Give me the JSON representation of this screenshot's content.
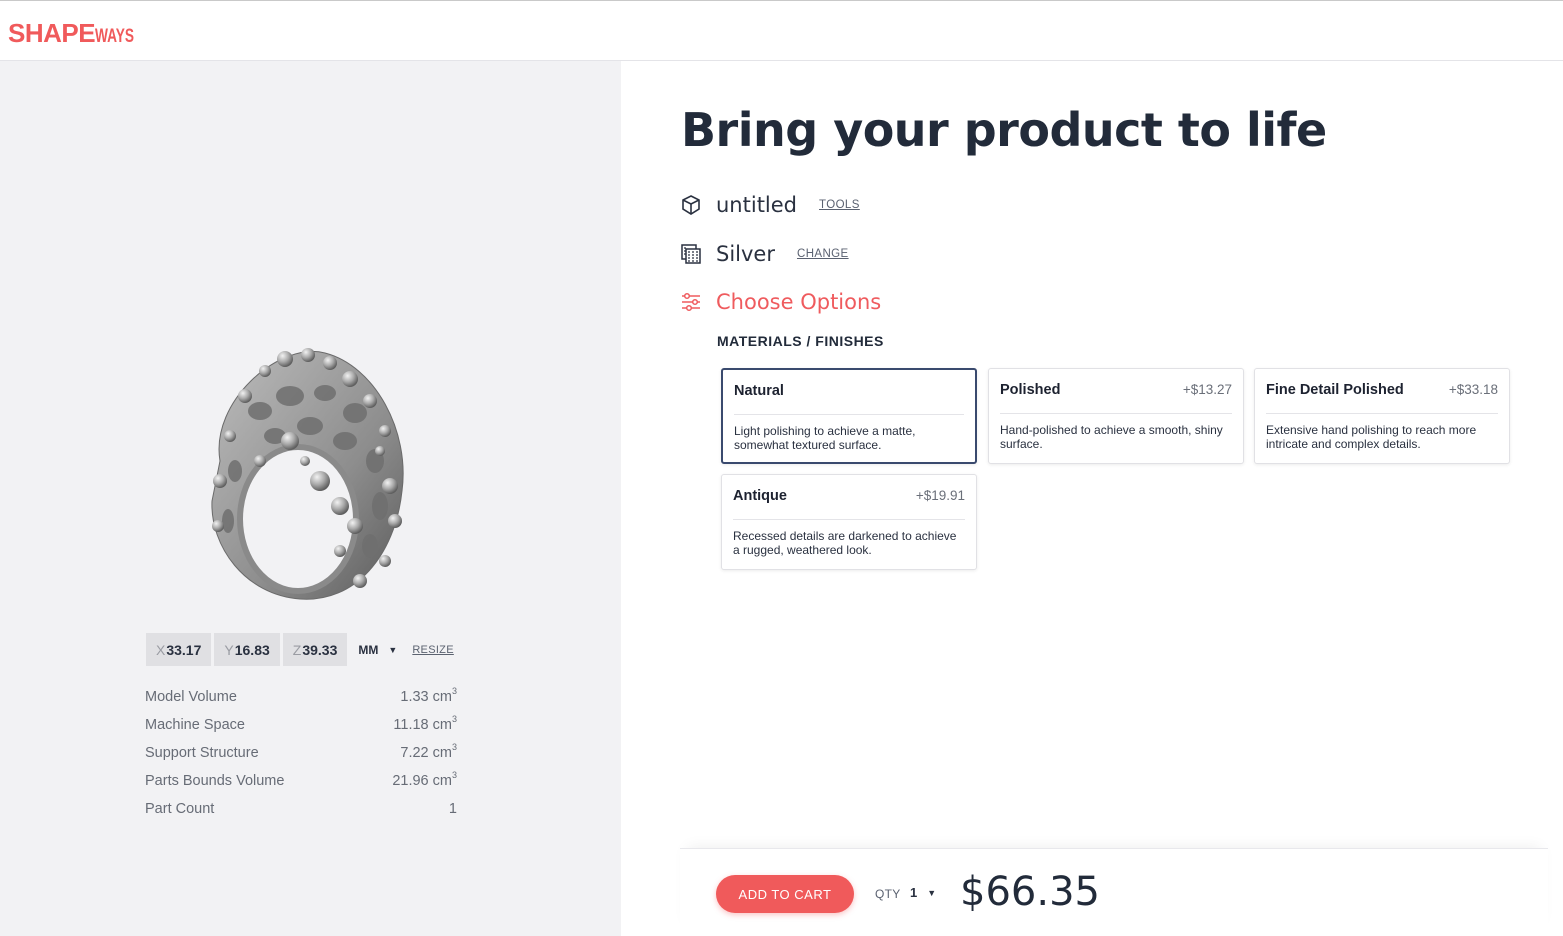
{
  "brand": {
    "logo_main": "SHAPE",
    "logo_tail": "WAYS",
    "color": "#f05a5b"
  },
  "viewer": {
    "icon": "ring-model-render",
    "dimensions": [
      {
        "axis": "X",
        "value": "33.17"
      },
      {
        "axis": "Y",
        "value": "16.83"
      },
      {
        "axis": "Z",
        "value": "39.33"
      }
    ],
    "unit": "MM",
    "resize_label": "RESIZE"
  },
  "stats": [
    {
      "label": "Model Volume",
      "value": "1.33 cm",
      "sup": "3"
    },
    {
      "label": "Machine Space",
      "value": "11.18 cm",
      "sup": "3"
    },
    {
      "label": "Support Structure",
      "value": "7.22 cm",
      "sup": "3"
    },
    {
      "label": "Parts Bounds Volume",
      "value": "21.96 cm",
      "sup": "3"
    },
    {
      "label": "Part Count",
      "value": "1",
      "sup": ""
    }
  ],
  "main": {
    "title": "Bring your product to life",
    "model": {
      "name": "untitled",
      "link": "TOOLS",
      "icon": "cube-icon"
    },
    "material": {
      "name": "Silver",
      "link": "CHANGE",
      "icon": "material-swatch-icon"
    },
    "options": {
      "label": "Choose Options",
      "icon": "sliders-icon",
      "color": "#ef5b5e"
    },
    "section_label": "MATERIALS / FINISHES",
    "finishes": [
      {
        "name": "Natural",
        "price": "",
        "desc": "Light polishing to achieve a matte, somewhat textured surface.",
        "selected": true
      },
      {
        "name": "Polished",
        "price": "+$13.27",
        "desc": "Hand-polished to achieve a smooth, shiny surface.",
        "selected": false
      },
      {
        "name": "Fine Detail Polished",
        "price": "+$33.18",
        "desc": "Extensive hand polishing to reach more intricate and complex details.",
        "selected": false
      },
      {
        "name": "Antique",
        "price": "+$19.91",
        "desc": "Recessed details are darkened to achieve a rugged, weathered look.",
        "selected": false
      }
    ]
  },
  "footer": {
    "add_to_cart": "ADD TO CART",
    "qty_label": "QTY",
    "qty_value": "1",
    "total": "$66.35"
  }
}
